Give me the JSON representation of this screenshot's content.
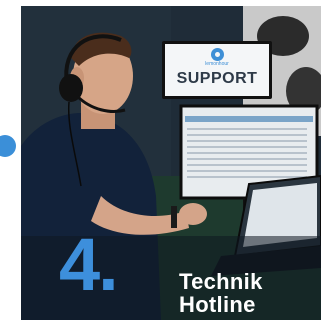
{
  "sign": {
    "brand": "lemonhour",
    "label": "SUPPORT"
  },
  "hero": {
    "number": "4.",
    "line1": "Technik",
    "line2": "Hotline"
  },
  "colors": {
    "accent": "#3d8fdc",
    "background": "#1d2a36",
    "text": "#ffffff"
  }
}
